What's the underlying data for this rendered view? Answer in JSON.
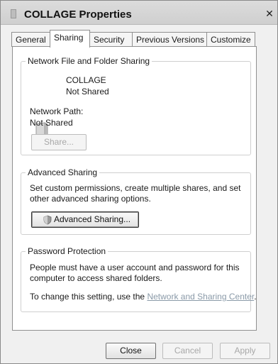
{
  "window": {
    "title": "COLLAGE Properties"
  },
  "tabs": [
    {
      "label": "General"
    },
    {
      "label": "Sharing"
    },
    {
      "label": "Security"
    },
    {
      "label": "Previous Versions"
    },
    {
      "label": "Customize"
    }
  ],
  "network_sharing": {
    "legend": "Network File and Folder Sharing",
    "folder_name": "COLLAGE",
    "folder_status": "Not Shared",
    "path_label": "Network Path:",
    "path_value": "Not Shared",
    "share_button": "Share..."
  },
  "advanced_sharing": {
    "legend": "Advanced Sharing",
    "description": "Set custom permissions, create multiple shares, and set other advanced sharing options.",
    "button": "Advanced Sharing..."
  },
  "password_protection": {
    "legend": "Password Protection",
    "description": "People must have a user account and password for this computer to access shared folders.",
    "change_prefix": "To change this setting, use the ",
    "link": "Network and Sharing Center",
    "change_suffix": "."
  },
  "footer": {
    "close": "Close",
    "cancel": "Cancel",
    "apply": "Apply"
  }
}
